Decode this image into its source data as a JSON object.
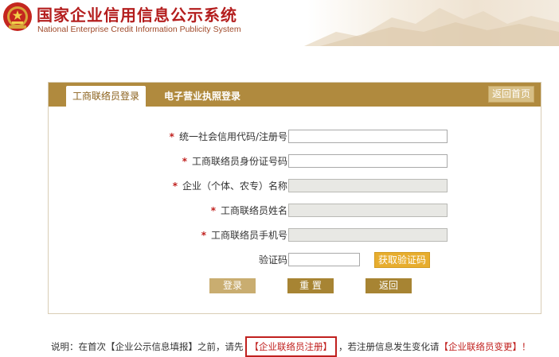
{
  "header": {
    "title": "国家企业信用信息公示系统",
    "subtitle": "National Enterprise Credit Information Publicity System"
  },
  "tabs": [
    {
      "label": "工商联络员登录",
      "active": true
    },
    {
      "label": "电子营业执照登录",
      "active": false
    }
  ],
  "home_button": "返回首页",
  "required_mark": "*",
  "form": {
    "fields": [
      {
        "label": "统一社会信用代码/注册号",
        "required": true,
        "disabled": false,
        "value": ""
      },
      {
        "label": "工商联络员身份证号码",
        "required": true,
        "disabled": false,
        "value": ""
      },
      {
        "label": "企业（个体、农专）名称",
        "required": true,
        "disabled": true,
        "value": ""
      },
      {
        "label": "工商联络员姓名",
        "required": true,
        "disabled": true,
        "value": ""
      },
      {
        "label": "工商联络员手机号",
        "required": true,
        "disabled": true,
        "value": ""
      }
    ],
    "captcha_label": "验证码",
    "captcha_button": "获取验证码"
  },
  "buttons": {
    "login": "登录",
    "reset": "重  置",
    "back": "返回"
  },
  "notice": {
    "part1": "说明：在首次【企业公示信息填报】之前，请先",
    "register_link": "【企业联络员注册】",
    "part2": "，若注册信息发生变化请",
    "change_link": "【企业联络员变更】",
    "part3": "！"
  },
  "colors": {
    "title_red": "#b41e1e",
    "tab_bar": "#b08a3e",
    "button_gold": "#a78433",
    "captcha_orange": "#e7ad2e"
  }
}
